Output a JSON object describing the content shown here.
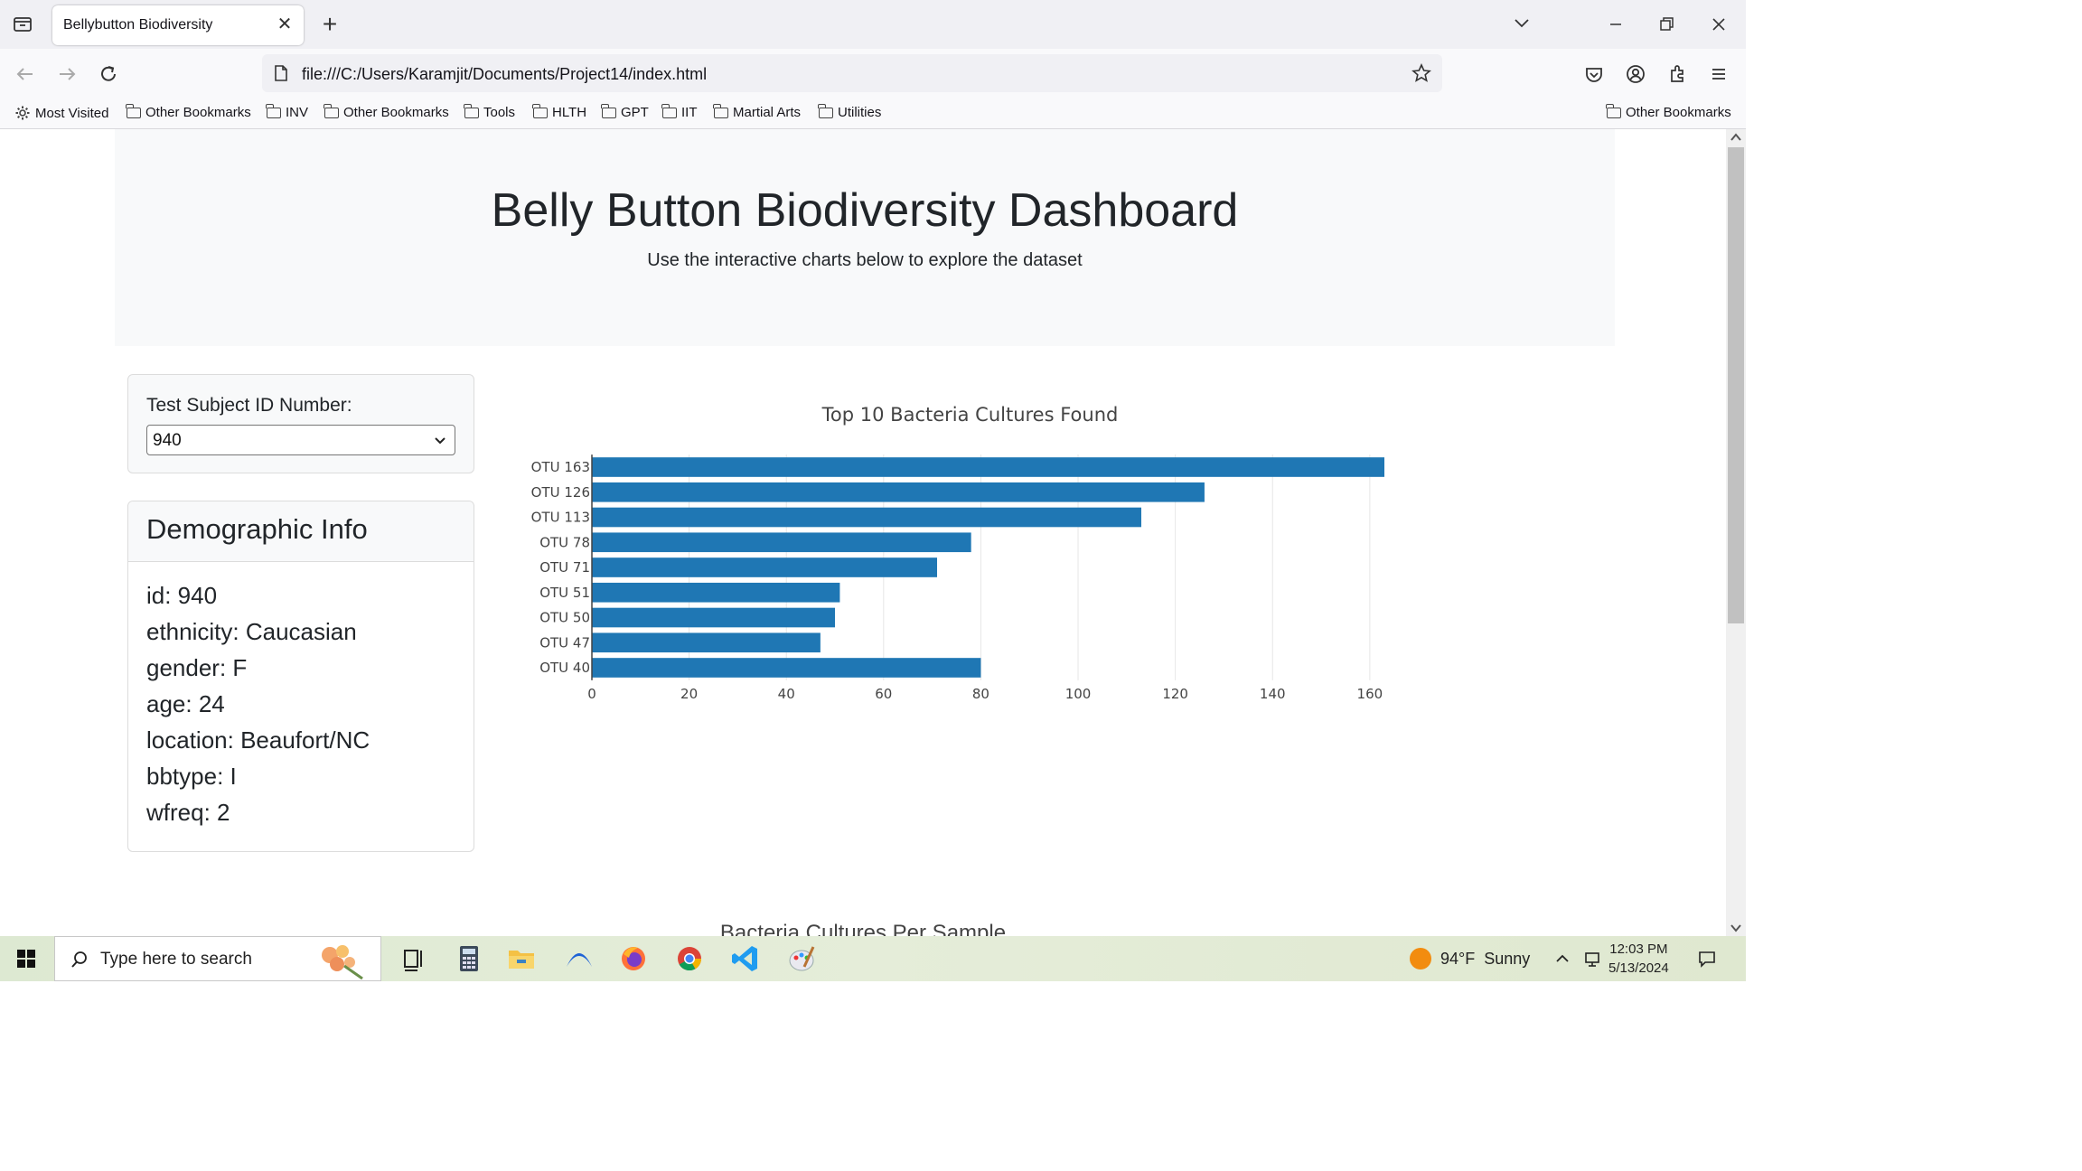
{
  "browser": {
    "tab_title": "Bellybutton Biodiversity",
    "url": "file:///C:/Users/Karamjit/Documents/Project14/index.html",
    "bookmarks": [
      "Most Visited",
      "Other Bookmarks",
      "INV",
      "Other Bookmarks",
      "Tools",
      "HLTH",
      "GPT",
      "IIT",
      "Martial Arts",
      "Utilities"
    ],
    "bookmarks_right": "Other Bookmarks"
  },
  "page": {
    "title": "Belly Button Biodiversity Dashboard",
    "subtitle": "Use the interactive charts below to explore the dataset",
    "select_label": "Test Subject ID Number:",
    "selected_id": "940",
    "demo_title": "Demographic Info",
    "demographics": [
      "id: 940",
      "ethnicity: Caucasian",
      "gender: F",
      "age: 24",
      "location: Beaufort/NC",
      "bbtype: I",
      "wfreq: 2"
    ],
    "second_chart_title": "Bacteria Cultures Per Sample"
  },
  "chart_data": {
    "type": "bar",
    "orientation": "horizontal",
    "title": "Top 10 Bacteria Cultures Found",
    "categories": [
      "OTU 163",
      "OTU 126",
      "OTU 113",
      "OTU 78",
      "OTU 71",
      "OTU 51",
      "OTU 50",
      "OTU 47",
      "OTU 40"
    ],
    "values": [
      163,
      126,
      113,
      78,
      71,
      51,
      50,
      47,
      80
    ],
    "xlim": [
      0,
      163
    ],
    "xticks": [
      0,
      20,
      40,
      60,
      80,
      100,
      120,
      140,
      160
    ],
    "grid": true,
    "bar_color": "#1f77b4"
  },
  "taskbar": {
    "search_placeholder": "Type here to search",
    "weather": "94°F  Sunny",
    "time": "12:03 PM",
    "date": "5/13/2024"
  }
}
